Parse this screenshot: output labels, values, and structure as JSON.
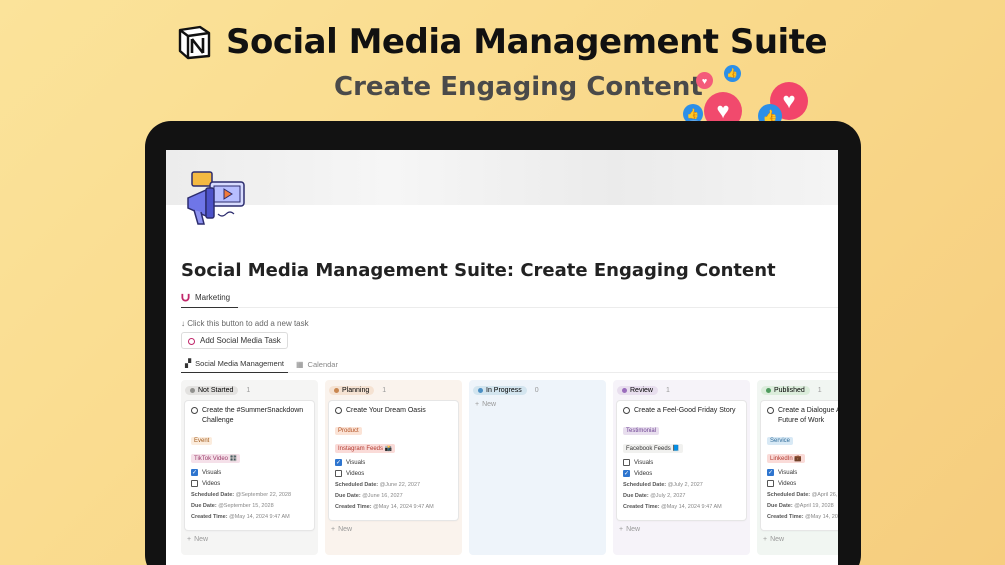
{
  "banner": {
    "title": "Social Media Management Suite",
    "subtitle": "Create Engaging Content"
  },
  "notion": {
    "page_title": "Social Media Management Suite: Create Engaging Content",
    "tab_label": "Marketing",
    "hint": "↓ Click this button to add a new task",
    "add_button": "Add Social Media Task",
    "views": [
      "Social Media Management",
      "Calendar"
    ],
    "columns": [
      {
        "name": "Not Started",
        "count": "1",
        "bg": "#f5f5f4",
        "pill_bg": "#e3e2e0",
        "dot": "#91918e",
        "cards": [
          {
            "title": "Create the #SummerSnackdown Challenge",
            "tags": [
              {
                "text": "Event",
                "bg": "#fbecdd",
                "color": "#a15a1b"
              },
              {
                "text": "TikTok Video 🎛️",
                "bg": "#f5e0e9",
                "color": "#9b3d6a"
              }
            ],
            "visuals": true,
            "videos": false,
            "scheduled": "@September 22, 2028",
            "due": "@September 15, 2028",
            "created": "@May 14, 2024 9:47 AM"
          }
        ],
        "new": "New"
      },
      {
        "name": "Planning",
        "count": "1",
        "bg": "#faf3ed",
        "pill_bg": "#f5e2d2",
        "dot": "#c98750",
        "cards": [
          {
            "title": "Create Your Dream Oasis",
            "tags": [
              {
                "text": "Product",
                "bg": "#fbe3d6",
                "color": "#b04e1f"
              },
              {
                "text": "Instagram Feeds 📸",
                "bg": "#fadbd8",
                "color": "#b23a30"
              }
            ],
            "visuals": true,
            "videos": false,
            "scheduled": "@June 22, 2027",
            "due": "@June 16, 2027",
            "created": "@May 14, 2024 9:47 AM"
          }
        ],
        "new": "New"
      },
      {
        "name": "In Progress",
        "count": "0",
        "bg": "#eef4fa",
        "pill_bg": "#d3e5ef",
        "dot": "#4b8fc4",
        "cards": [],
        "new": "New"
      },
      {
        "name": "Review",
        "count": "1",
        "bg": "#f6f3f9",
        "pill_bg": "#e8deee",
        "dot": "#9a6dbc",
        "cards": [
          {
            "title": "Create a Feel-Good Friday Story",
            "tags": [
              {
                "text": "Testimonial",
                "bg": "#e8deee",
                "color": "#6b3f91"
              },
              {
                "text": "Facebook Feeds 📘",
                "bg": "#f1f1ef",
                "color": "#333333"
              }
            ],
            "visuals": false,
            "videos": true,
            "scheduled": "@July 2, 2027",
            "due": "@July 2, 2027",
            "created": "@May 14, 2024 9:47 AM"
          }
        ],
        "new": "New"
      },
      {
        "name": "Published",
        "count": "1",
        "bg": "#f1f6f2",
        "pill_bg": "#dbeddb",
        "dot": "#4f9b5e",
        "cards": [
          {
            "title": "Create a Dialogue About the Future of Work",
            "tags": [
              {
                "text": "Service",
                "bg": "#d8e9f5",
                "color": "#2d6a98"
              },
              {
                "text": "LinkedIn 💼",
                "bg": "#fadbd8",
                "color": "#b23a30"
              }
            ],
            "visuals": true,
            "videos": false,
            "scheduled": "@April 26, 2028",
            "due": "@April 19, 2028",
            "created": "@May 14, 2024 9:47 AM"
          }
        ],
        "new": "New"
      }
    ],
    "labels": {
      "visuals": "Visuals",
      "videos": "Videos",
      "scheduled": "Scheduled Date:",
      "due": "Due Date:",
      "created": "Created Time:"
    }
  },
  "icons": [
    "notion-logo-icon",
    "heart-icon",
    "like-icon",
    "magnet-icon",
    "megaphone-video-icon"
  ]
}
